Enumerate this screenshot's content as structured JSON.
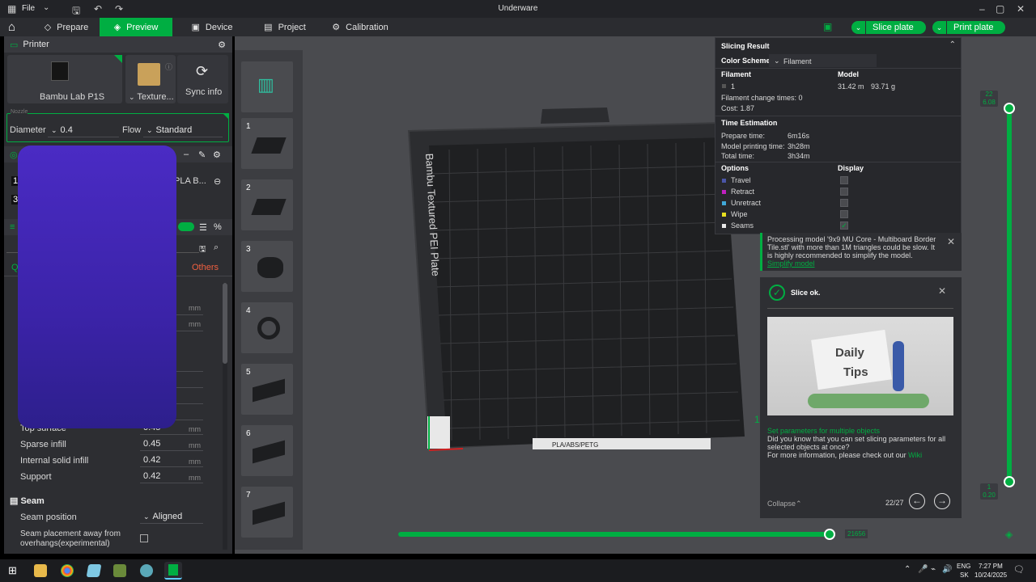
{
  "app": {
    "title": "Underware",
    "file_menu": "File"
  },
  "tabs": [
    {
      "label": "Prepare"
    },
    {
      "label": "Preview"
    },
    {
      "label": "Device"
    },
    {
      "label": "Project"
    },
    {
      "label": "Calibration"
    }
  ],
  "actions": {
    "slice": "Slice plate",
    "print": "Print plate"
  },
  "printer": {
    "section": "Printer",
    "name": "Bambu Lab P1S",
    "plate": "Texture...",
    "sync": "Sync info",
    "nozzle_label": "Nozzle",
    "diameter_label": "Diameter",
    "diameter_value": "0.4",
    "flow_label": "Flow",
    "flow_value": "Standard"
  },
  "filament": {
    "row1_num": "1",
    "row1_name": "PLA B...",
    "row2_num": "3"
  },
  "process": {
    "tab_quality": "Q",
    "tab_others": "Others",
    "rows": [
      {
        "label": "Top surface",
        "value": "0.45",
        "unit": "mm"
      },
      {
        "label": "Sparse infill",
        "value": "0.45",
        "unit": "mm"
      },
      {
        "label": "Internal solid infill",
        "value": "0.42",
        "unit": "mm"
      },
      {
        "label": "Support",
        "value": "0.42",
        "unit": "mm"
      }
    ],
    "seam_section": "Seam",
    "seam_position_label": "Seam position",
    "seam_position_value": "Aligned",
    "seam_away_label_1": "Seam placement away from",
    "seam_away_label_2": "overhangs(experimental)"
  },
  "thumbnails": [
    "1",
    "2",
    "3",
    "4",
    "5",
    "6",
    "7"
  ],
  "plate_label": "Bambu Textured PEI Plate",
  "plate_tag": "PLA/ABS/PETG",
  "slicing_result": {
    "title": "Slicing Result",
    "color_scheme_label": "Color Scheme",
    "color_scheme_value": "Filament",
    "filament_header": "Filament",
    "model_header": "Model",
    "filament_num": "1",
    "length": "31.42 m",
    "weight": "93.71 g",
    "change_times": "Filament change times:  0",
    "cost": "Cost:  1.87",
    "time_header": "Time Estimation",
    "prepare_label": "Prepare time:",
    "prepare_value": "6m16s",
    "model_time_label": "Model printing time:",
    "model_time_value": "3h28m",
    "total_label": "Total time:",
    "total_value": "3h34m",
    "options_header": "Options",
    "display_header": "Display",
    "options": [
      {
        "label": "Travel",
        "color": "#4a55a8",
        "checked": false
      },
      {
        "label": "Retract",
        "color": "#c020c0",
        "checked": false
      },
      {
        "label": "Unretract",
        "color": "#40a8d8",
        "checked": false
      },
      {
        "label": "Wipe",
        "color": "#e8e020",
        "checked": false
      },
      {
        "label": "Seams",
        "color": "#e8e8e8",
        "checked": true
      }
    ]
  },
  "warning": {
    "line1": "Processing model '9x9 MU Core - Multiboard Border",
    "line2": "Tile.stl' with more than 1M triangles could be slow. It",
    "line3": "is highly recommended to simplify the model.",
    "link": "Simplify model"
  },
  "slice_ok": {
    "title": "Slice ok.",
    "image_text_1": "Daily",
    "image_text_2": "Tips",
    "tip_title": "Set parameters for multiple objects",
    "tip_line1": "Did you know that you can set slicing parameters for all",
    "tip_line2": "selected objects at once?",
    "tip_line3": "For more information, please check out our",
    "tip_link": "Wiki",
    "collapse": "Collapse",
    "page": "22/27"
  },
  "layer_slider": {
    "top_layer": "22",
    "top_height": "6.08",
    "bottom_layer": "1",
    "bottom_height": "0.20"
  },
  "move_slider": {
    "value": "21656",
    "fraction": 1.0
  },
  "axis_label": "1",
  "taskbar": {
    "lang": "ENG",
    "region": "SK",
    "time": "7:27 PM",
    "date": "10/24/2025"
  },
  "colors": {
    "accent": "#00ae42",
    "panel": "#2d2e32",
    "canvas": "#4a4b4f"
  }
}
